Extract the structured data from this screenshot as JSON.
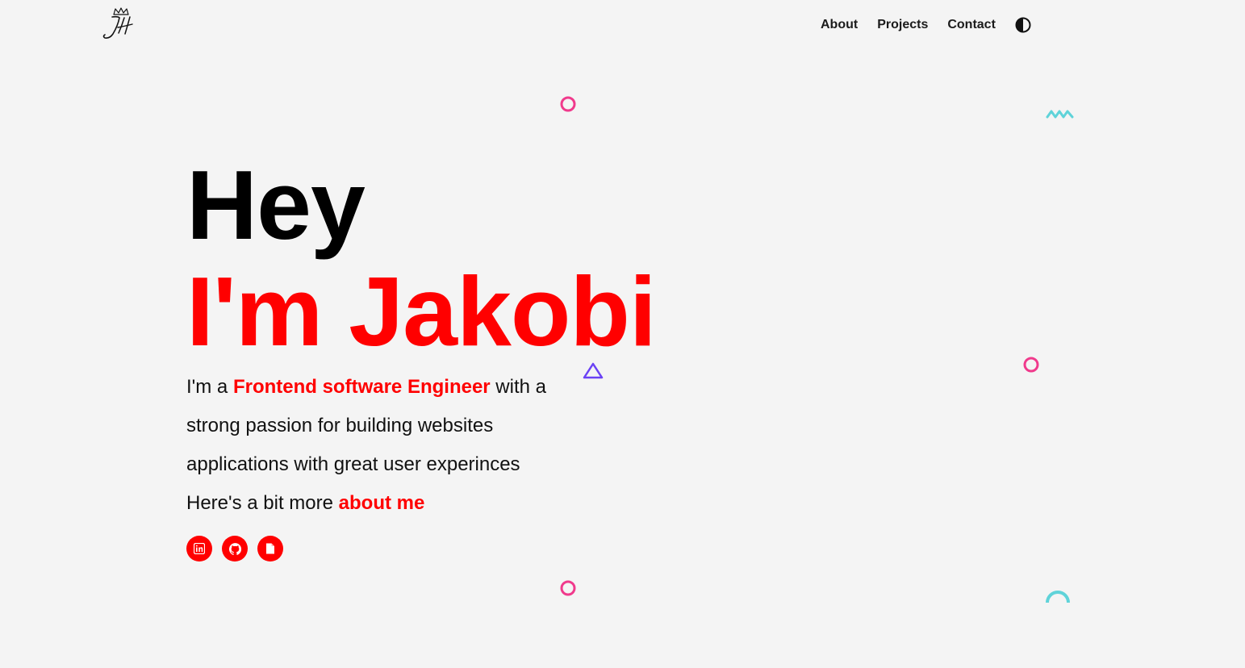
{
  "header": {
    "logo_icon": "jh-crown-signature-logo",
    "nav": [
      {
        "label": "About"
      },
      {
        "label": "Projects"
      },
      {
        "label": "Contact"
      }
    ],
    "theme_toggle_icon": "half-circle-contrast-icon"
  },
  "hero": {
    "line1": "Hey",
    "line2": "I'm Jakobi",
    "intro": {
      "prefix": "I'm a ",
      "role": "Frontend software Engineer",
      "rest1": " with a",
      "line2": "strong passion for building websites",
      "line3": "applications with great user experinces",
      "more_prefix": "Here's a bit more ",
      "more_link": "about me"
    },
    "socials": [
      {
        "icon": "linkedin-icon"
      },
      {
        "icon": "github-icon"
      },
      {
        "icon": "document-icon"
      }
    ]
  },
  "colors": {
    "accent": "#ff0000",
    "background": "#f4f4f4",
    "deco_pink": "#f03a8c",
    "deco_cyan": "#5fd3d9",
    "deco_purple": "#6a42f5"
  }
}
